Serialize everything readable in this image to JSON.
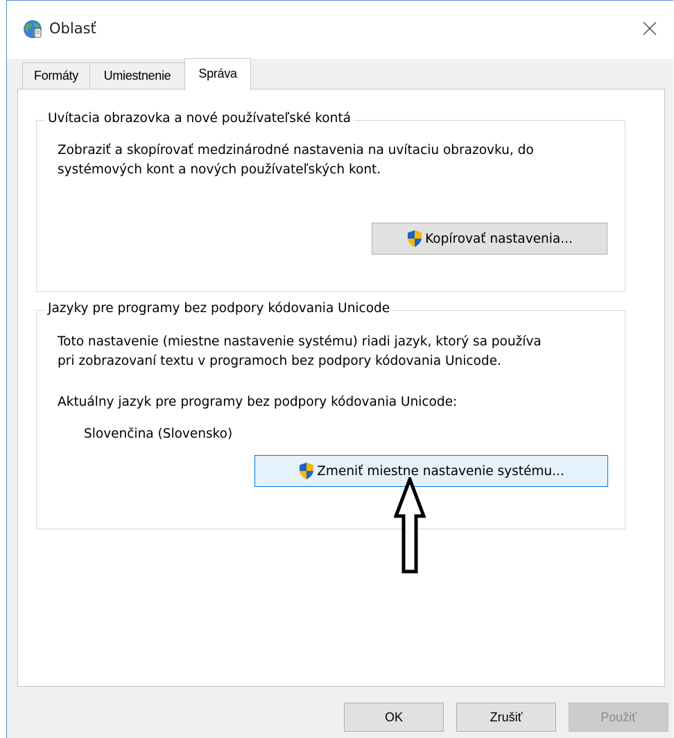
{
  "window": {
    "title": "Oblasť",
    "close_symbol": "✕",
    "title_icon": "globe-region-icon"
  },
  "tabs": [
    {
      "label": "Formáty",
      "active": false
    },
    {
      "label": "Umiestnenie",
      "active": false
    },
    {
      "label": "Správa",
      "active": true
    }
  ],
  "welcome_group": {
    "title": "Uvítacia obrazovka a nové používateľské kontá",
    "description_line1": "Zobraziť a skopírovať medzinárodné nastavenia na uvítaciu obrazovku, do",
    "description_line2": "systémových kont a nových používateľských kont.",
    "copy_button_label": "Kopírovať nastavenia...",
    "copy_button_icon": "uac-shield-icon"
  },
  "unicode_group": {
    "title": "Jazyky pre programy bez podpory kódovania Unicode",
    "description_line1": "Toto nastavenie (miestne nastavenie systému) riadi jazyk, ktorý sa používa",
    "description_line2": "pri zobrazovaní textu v programoch bez podpory kódovania Unicode.",
    "current_label": "Aktuálny jazyk pre programy bez podpory kódovania Unicode:",
    "current_value": "Slovenčina (Slovensko)",
    "change_button_label": "Zmeniť miestne nastavenie systému...",
    "change_button_icon": "uac-shield-icon"
  },
  "annotation": {
    "arrow_icon": "up-arrow-annotation-icon"
  },
  "buttons": {
    "ok": "OK",
    "cancel": "Zrušiť",
    "apply": "Použiť"
  },
  "colors": {
    "accent_blue": "#0078d7",
    "focused_button_bg": "#e5f1fb",
    "button_bg": "#e1e1e1",
    "dialog_bg": "#f0f0f0",
    "shield_blue": "#1e62c4",
    "shield_yellow": "#f5b800"
  }
}
